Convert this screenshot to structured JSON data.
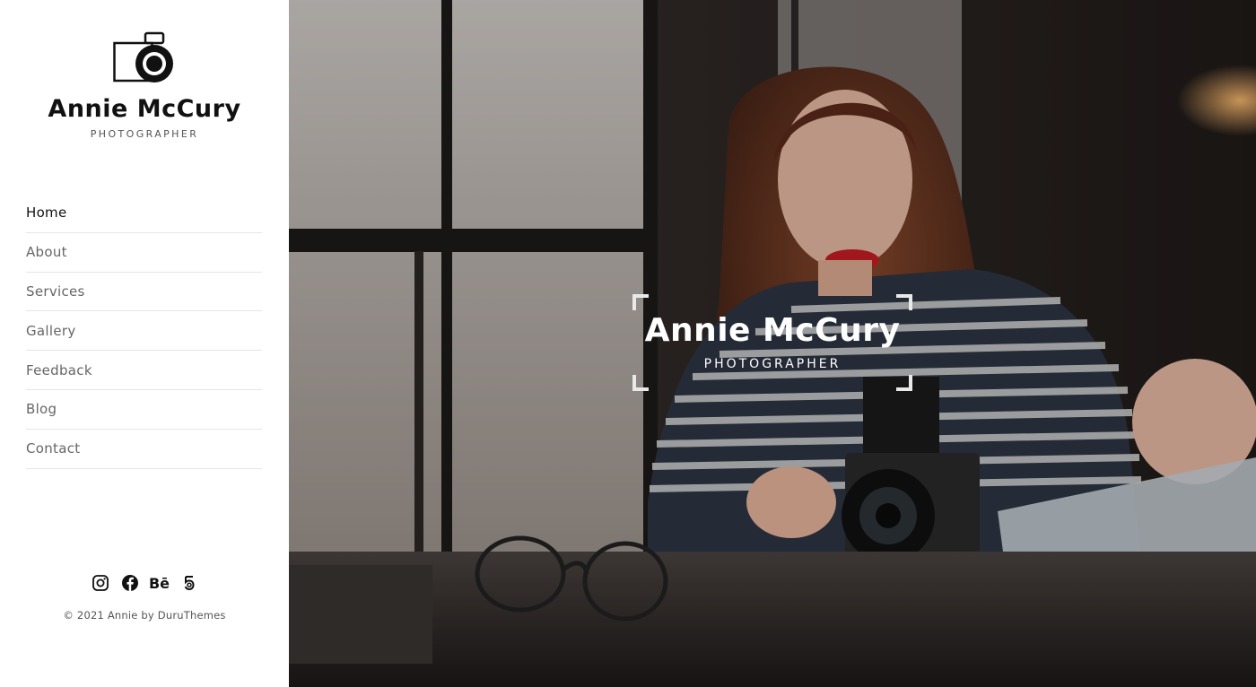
{
  "brand": {
    "name": "Annie McCury",
    "subtitle": "PHOTOGRAPHER",
    "logo_icon": "camera-icon"
  },
  "nav": {
    "items": [
      {
        "label": "Home",
        "active": true
      },
      {
        "label": "About",
        "active": false
      },
      {
        "label": "Services",
        "active": false
      },
      {
        "label": "Gallery",
        "active": false
      },
      {
        "label": "Feedback",
        "active": false
      },
      {
        "label": "Blog",
        "active": false
      },
      {
        "label": "Contact",
        "active": false
      }
    ]
  },
  "social": {
    "icons": [
      "instagram-icon",
      "facebook-icon",
      "behance-icon",
      "500px-icon"
    ],
    "behance_text": "Bē"
  },
  "footer": {
    "copyright": "© 2021 Annie by DuruThemes"
  },
  "hero": {
    "name": "Annie McCury",
    "subtitle": "PHOTOGRAPHER"
  },
  "colors": {
    "accent": "#111111",
    "nav_text": "#666666",
    "divider": "#e6e6e6"
  }
}
